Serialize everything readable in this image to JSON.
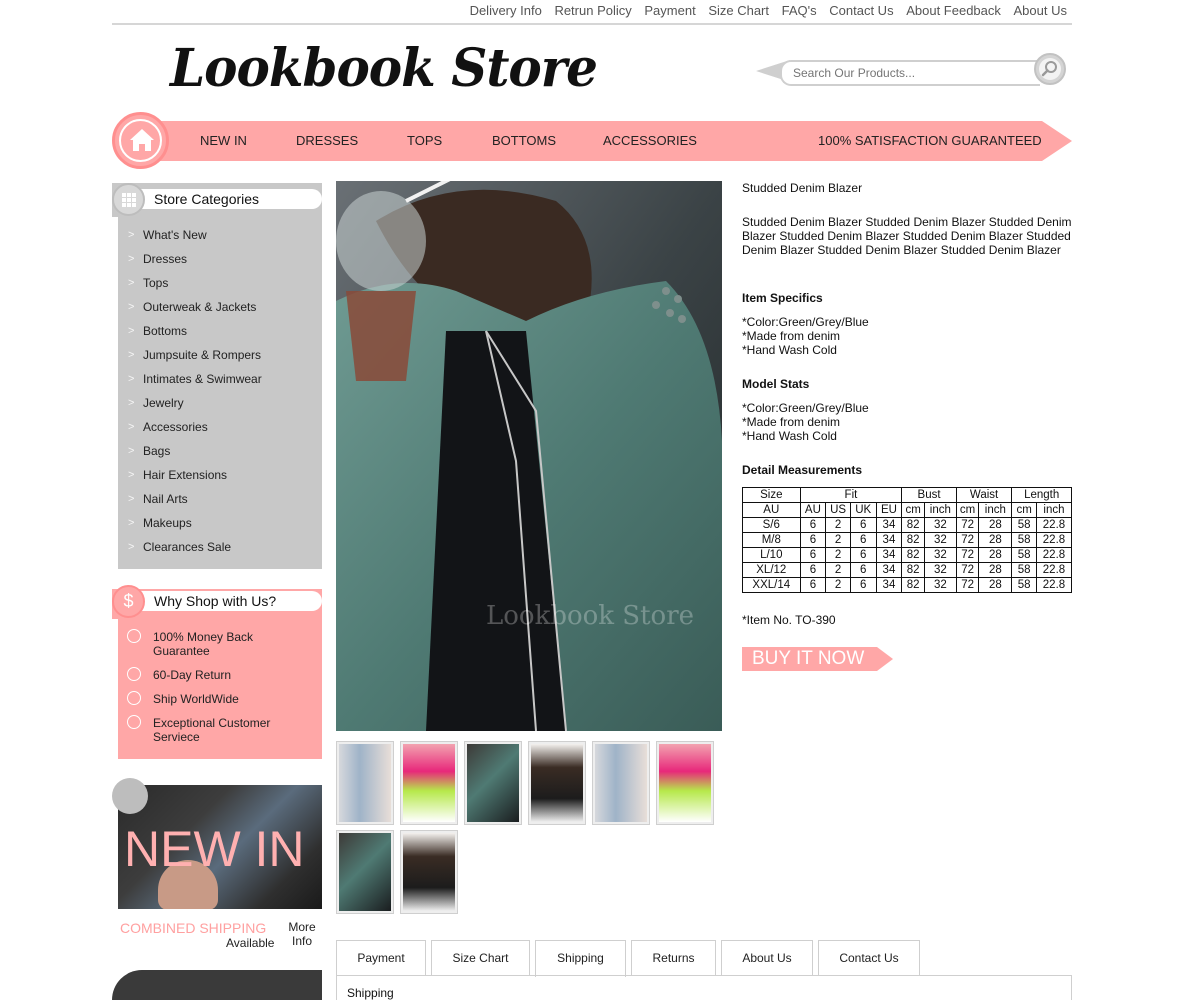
{
  "top_links": [
    "Delivery Info",
    "Retrun Policy",
    "Payment",
    "Size Chart",
    "FAQ's",
    "Contact Us",
    "About Feedback",
    "About Us"
  ],
  "logo": "Lookbook Store",
  "search": {
    "placeholder": "Search Our Products..."
  },
  "nav": {
    "items": [
      "NEW IN",
      "DRESSES",
      "TOPS",
      "BOTTOMS",
      "ACCESSORIES"
    ],
    "guarantee": "100% SATISFACTION GUARANTEED"
  },
  "sidebar": {
    "categories_title": "Store Categories",
    "categories": [
      "What's New",
      "Dresses",
      "Tops",
      "Outerweak & Jackets",
      "Bottoms",
      "Jumpsuite & Rompers",
      "Intimates & Swimwear",
      "Jewelry",
      "Accessories",
      "Bags",
      "Hair Extensions",
      "Nail Arts",
      "Makeups",
      "Clearances Sale"
    ],
    "why_title": "Why Shop with Us?",
    "why_items": [
      "100% Money Back Guarantee",
      "60-Day Return",
      "Ship WorldWide",
      "Exceptional Customer Serviece"
    ],
    "banner_text": "NEW IN",
    "combined_shipping": "COMBINED SHIPPING",
    "available": "Available",
    "more_info": "More Info"
  },
  "product": {
    "title": "Studded Denim Blazer",
    "description": "Studded Denim Blazer Studded Denim Blazer Studded Denim Blazer Studded Denim Blazer Studded Denim Blazer Studded Denim Blazer Studded Denim Blazer Studded Denim Blazer",
    "watermark": "Lookbook Store",
    "item_specifics_title": "Item Specifics",
    "item_specifics": [
      "*Color:Green/Grey/Blue",
      "*Made from denim",
      "*Hand Wash Cold"
    ],
    "model_stats_title": "Model Stats",
    "model_stats": [
      "*Color:Green/Grey/Blue",
      "*Made from denim",
      "*Hand Wash Cold"
    ],
    "measurements_title": "Detail Measurements",
    "measurements": {
      "group_headers": [
        "Size",
        "Fit",
        "Bust",
        "Waist",
        "Length"
      ],
      "sub_headers": [
        "AU",
        "AU",
        "US",
        "UK",
        "EU",
        "cm",
        "inch",
        "cm",
        "inch",
        "cm",
        "inch"
      ],
      "rows": [
        [
          "S/6",
          "6",
          "2",
          "6",
          "34",
          "82",
          "32",
          "72",
          "28",
          "58",
          "22.8"
        ],
        [
          "M/8",
          "6",
          "2",
          "6",
          "34",
          "82",
          "32",
          "72",
          "28",
          "58",
          "22.8"
        ],
        [
          "L/10",
          "6",
          "2",
          "6",
          "34",
          "82",
          "32",
          "72",
          "28",
          "58",
          "22.8"
        ],
        [
          "XL/12",
          "6",
          "2",
          "6",
          "34",
          "82",
          "32",
          "72",
          "28",
          "58",
          "22.8"
        ],
        [
          "XXL/14",
          "6",
          "2",
          "6",
          "34",
          "82",
          "32",
          "72",
          "28",
          "58",
          "22.8"
        ]
      ]
    },
    "item_no": "*Item No. TO-390",
    "buy_label": "BUY IT NOW"
  },
  "tabs": {
    "items": [
      "Payment",
      "Size Chart",
      "Shipping",
      "Returns",
      "About Us",
      "Contact Us"
    ],
    "active": "Shipping",
    "panel_text": "Shipping"
  },
  "colors": {
    "accent": "#ffa7a7",
    "sidebar_gray": "#c8c8c8"
  }
}
